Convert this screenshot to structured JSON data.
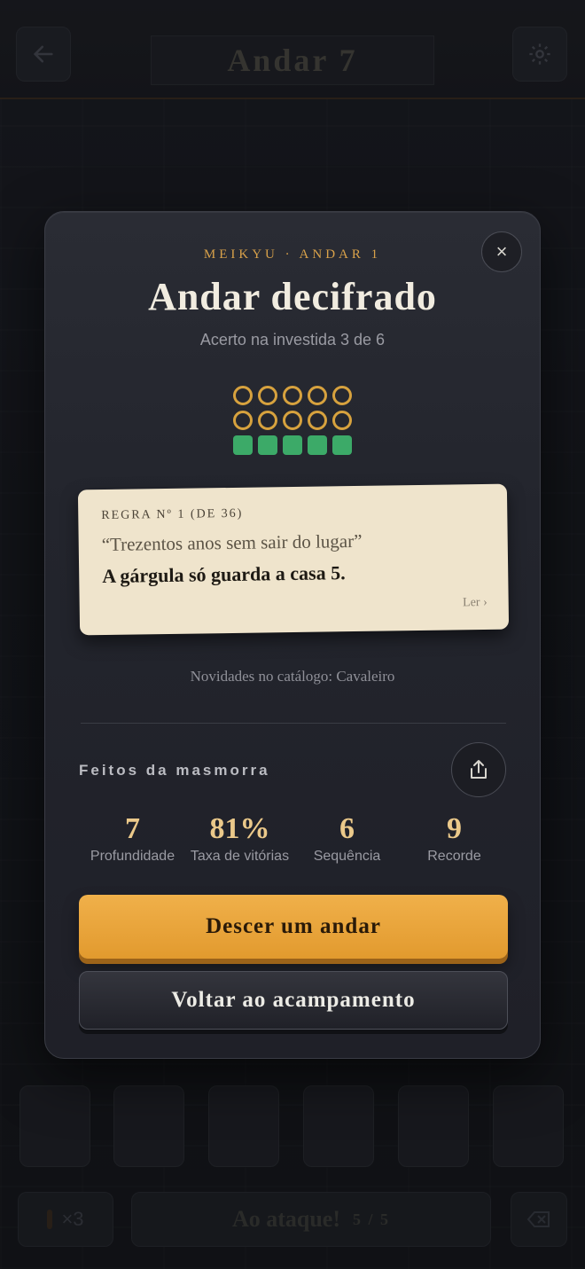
{
  "header": {
    "floor_title": "Andar 7",
    "back_icon": "arrow-left-icon",
    "settings_icon": "gear-icon"
  },
  "bottom_bar": {
    "torch_count": "×3",
    "attack_label": "Ao ataque!",
    "attack_count": "5 / 5"
  },
  "modal": {
    "eyebrow": "MEIKYU · ANDAR 1",
    "title": "Andar decifrado",
    "subtitle": "Acerto na investida 3 de 6",
    "attempt_rows": [
      [
        "ring",
        "ring",
        "ring",
        "ring",
        "ring"
      ],
      [
        "ring",
        "ring",
        "ring",
        "ring",
        "ring"
      ],
      [
        "hit",
        "hit",
        "hit",
        "hit",
        "hit"
      ]
    ],
    "rule": {
      "label": "REGRA Nº 1 (DE 36)",
      "quote": "“Trezentos anos sem sair do lugar”",
      "text": "A gárgula só guarda a casa 5.",
      "read_link": "Ler ›"
    },
    "catalog_note": "Novidades no catálogo: Cavaleiro",
    "feats_label": "Feitos da masmorra",
    "stats": [
      {
        "value": "7",
        "label": "Profundidade"
      },
      {
        "value": "81%",
        "label": "Taxa de vitórias"
      },
      {
        "value": "6",
        "label": "Sequência"
      },
      {
        "value": "9",
        "label": "Recorde"
      }
    ],
    "primary_button": "Descer um andar",
    "secondary_button": "Voltar ao acampamento",
    "close_label": "×"
  },
  "colors": {
    "accent_gold": "#d7a23e",
    "hit_green": "#3caa68",
    "primary_button": "#e29a2e"
  }
}
